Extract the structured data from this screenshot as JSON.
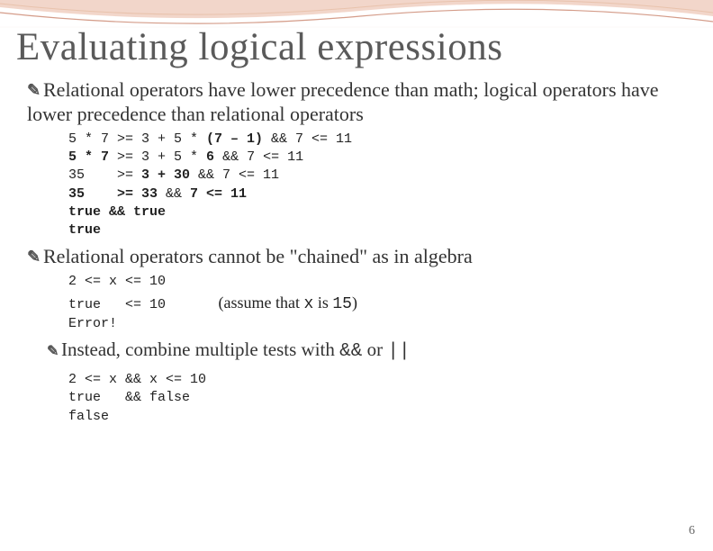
{
  "title": "Evaluating logical expressions",
  "bullet1": "Relational operators have lower precedence than math; logical operators have lower precedence than relational operators",
  "code1_l1a": "5 * 7 >= 3 + 5 * ",
  "code1_l1b": "(7 – 1)",
  "code1_l1c": " && 7 <= 11",
  "code1_l2a": "5 * 7",
  "code1_l2b": " >= 3 + 5 * ",
  "code1_l2c": "6",
  "code1_l2d": " && 7 <= 11",
  "code1_l3a": "35    >= ",
  "code1_l3b": "3 + 30",
  "code1_l3c": " && 7 <= 11",
  "code1_l4a": "35    >= 33",
  "code1_l4b": " && ",
  "code1_l4c": "7 <= 11",
  "code1_l5a": "true && true",
  "code1_l6a": "true",
  "bullet2": "Relational operators cannot be \"chained\" as in algebra",
  "code2_l1": "2 <= x",
  "code2_l1b": " <= 10",
  "code2_l2a": "true",
  "code2_l2b": "   <= 10",
  "note_prefix": "(assume that ",
  "note_x": "x",
  "note_mid": " is ",
  "note_val": "15",
  "note_suffix": ")",
  "code2_l3": "Error!",
  "sub_prefix": "Instead, combine multiple tests with ",
  "sub_and": "&&",
  "sub_or_word": " or ",
  "sub_or": "||",
  "code3_l1a": "2 <= x",
  "code3_l1b": " && ",
  "code3_l1c": "x <= 10",
  "code3_l2a": "true",
  "code3_l2b": "   && ",
  "code3_l2c": "false",
  "code3_l3": "false",
  "page_num": "6"
}
